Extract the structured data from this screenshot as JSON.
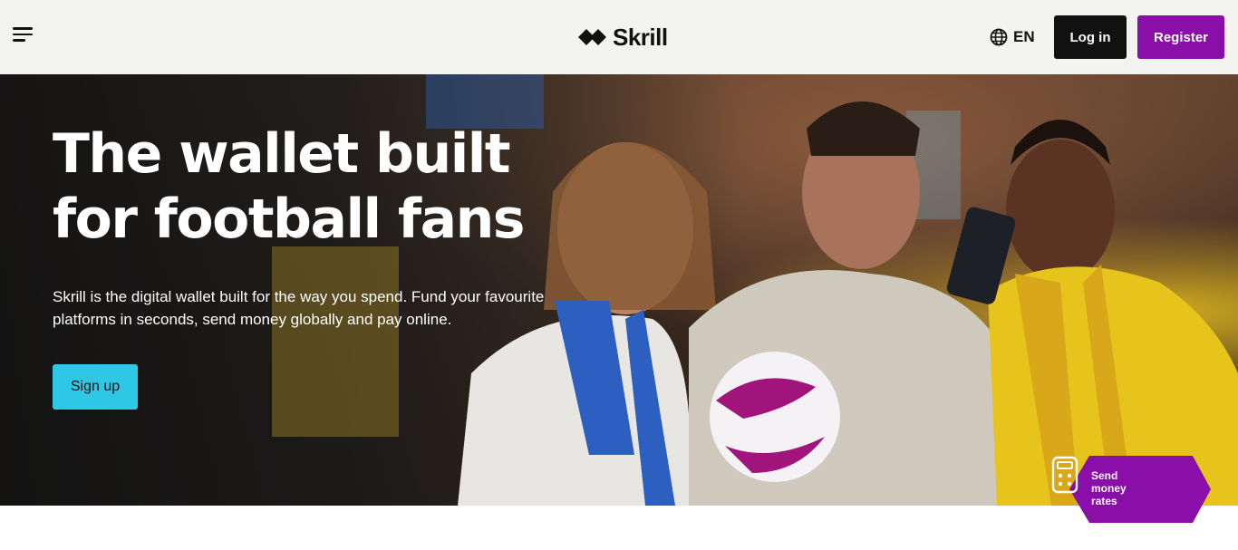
{
  "header": {
    "brand": "Skrill",
    "language": "EN",
    "login_label": "Log in",
    "register_label": "Register"
  },
  "hero": {
    "title": "The wallet built for football fans",
    "subtitle": "Skrill is the digital wallet built for the way you spend. Fund your favourite platforms in seconds, send money globally and pay online.",
    "signup_label": "Sign up"
  },
  "rates_badge": {
    "label": "Send money rates"
  },
  "colors": {
    "header_bg": "#f3f3ef",
    "brand_purple": "#8a0fa8",
    "signup_cyan": "#2ec8e6",
    "dark": "#111111"
  },
  "icons": [
    "menu-icon",
    "skrill-logo-icon",
    "globe-icon",
    "calculator-icon"
  ]
}
